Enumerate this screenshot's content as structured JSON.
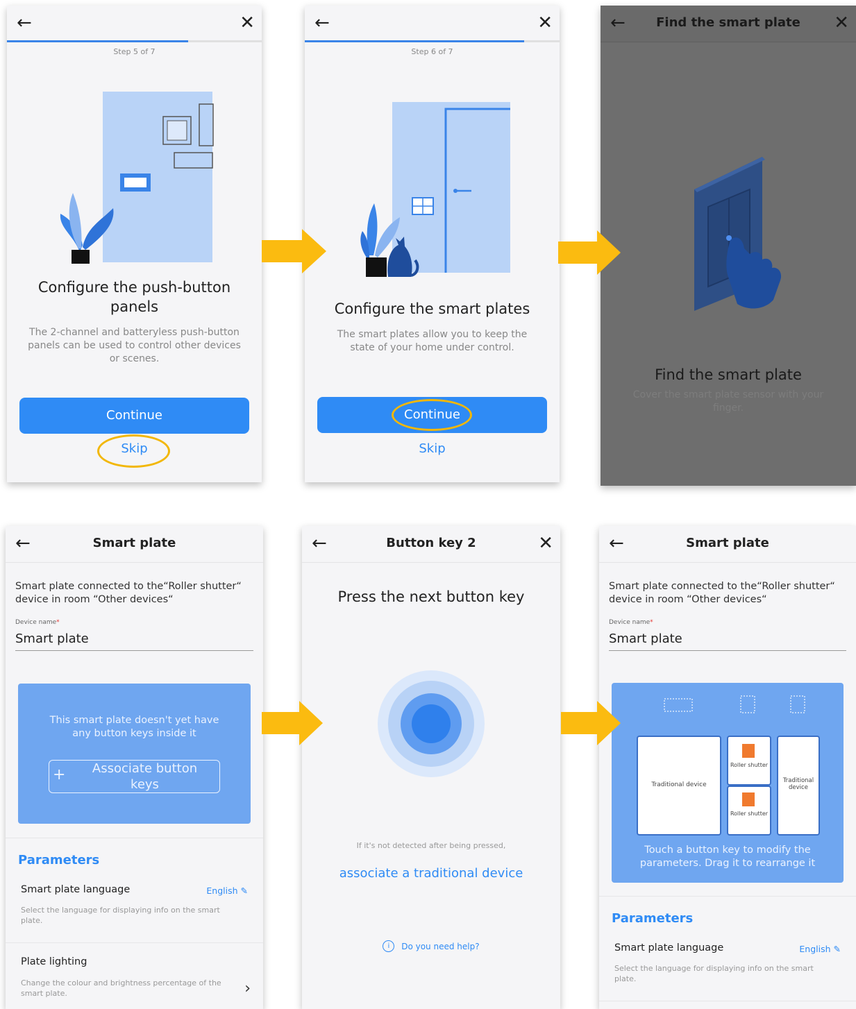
{
  "s1": {
    "step": "Step 5 of 7",
    "title": "Configure the push-button panels",
    "description": "The 2-channel and batteryless push-button panels can be used to control other devices or scenes.",
    "continue_label": "Continue",
    "skip_label": "Skip",
    "progress": 0.71
  },
  "s2": {
    "step": "Step 6 of 7",
    "title": "Configure the smart plates",
    "description": "The smart plates allow you to keep the state of your home under control.",
    "continue_label": "Continue",
    "skip_label": "Skip",
    "progress": 0.86
  },
  "s3": {
    "bar_title": "Find the smart plate",
    "title": "Find the smart plate",
    "description": "Cover the smart plate sensor with your finger."
  },
  "s4": {
    "bar_title": "Smart plate",
    "intro": "Smart plate connected to the“Roller shutter“ device in room “Other devices“",
    "field_label": "Device name",
    "field_required": "*",
    "field_value": "Smart plate",
    "empty_text": "This smart plate doesn't yet have any button keys inside it",
    "associate_label": "Associate button keys",
    "params_title": "Parameters",
    "lang_title": "Smart plate language",
    "lang_value": "English",
    "lang_desc": "Select the language for displaying info on the smart plate.",
    "light_title": "Plate lighting",
    "light_desc": "Change the colour and brightness percentage of the smart plate."
  },
  "s5": {
    "bar_title": "Button key 2",
    "title": "Press the next button key",
    "hint": "If it's not detected after being pressed,",
    "associate_link": "associate a traditional device",
    "help_label": "Do you need help?"
  },
  "s6": {
    "bar_title": "Smart plate",
    "intro": "Smart plate connected to the“Roller shutter“ device in room “Other devices“",
    "field_label": "Device name",
    "field_required": "*",
    "field_value": "Smart plate",
    "key_left": "Traditional device",
    "key_top": "Roller shutter",
    "key_bottom": "Roller shutter",
    "key_right": "Traditional device",
    "touch_hint": "Touch a button key to modify the parameters. Drag it to rearrange it",
    "params_title": "Parameters",
    "lang_title": "Smart plate language",
    "lang_value": "English",
    "lang_desc": "Select the language for displaying info on the smart plate."
  },
  "colors": {
    "accent": "#2f8bf5",
    "highlight": "#f2b705",
    "arrow": "#fbbb10",
    "illustration_blue": "#b9d3f7",
    "card_blue": "#6fa6f0",
    "overlay": "#6e6e6e"
  },
  "icons": [
    "back-arrow-icon",
    "close-icon",
    "plant-icon",
    "cat-icon",
    "hand-icon",
    "info-icon",
    "edit-icon",
    "chevron-right-icon",
    "plus-icon"
  ]
}
